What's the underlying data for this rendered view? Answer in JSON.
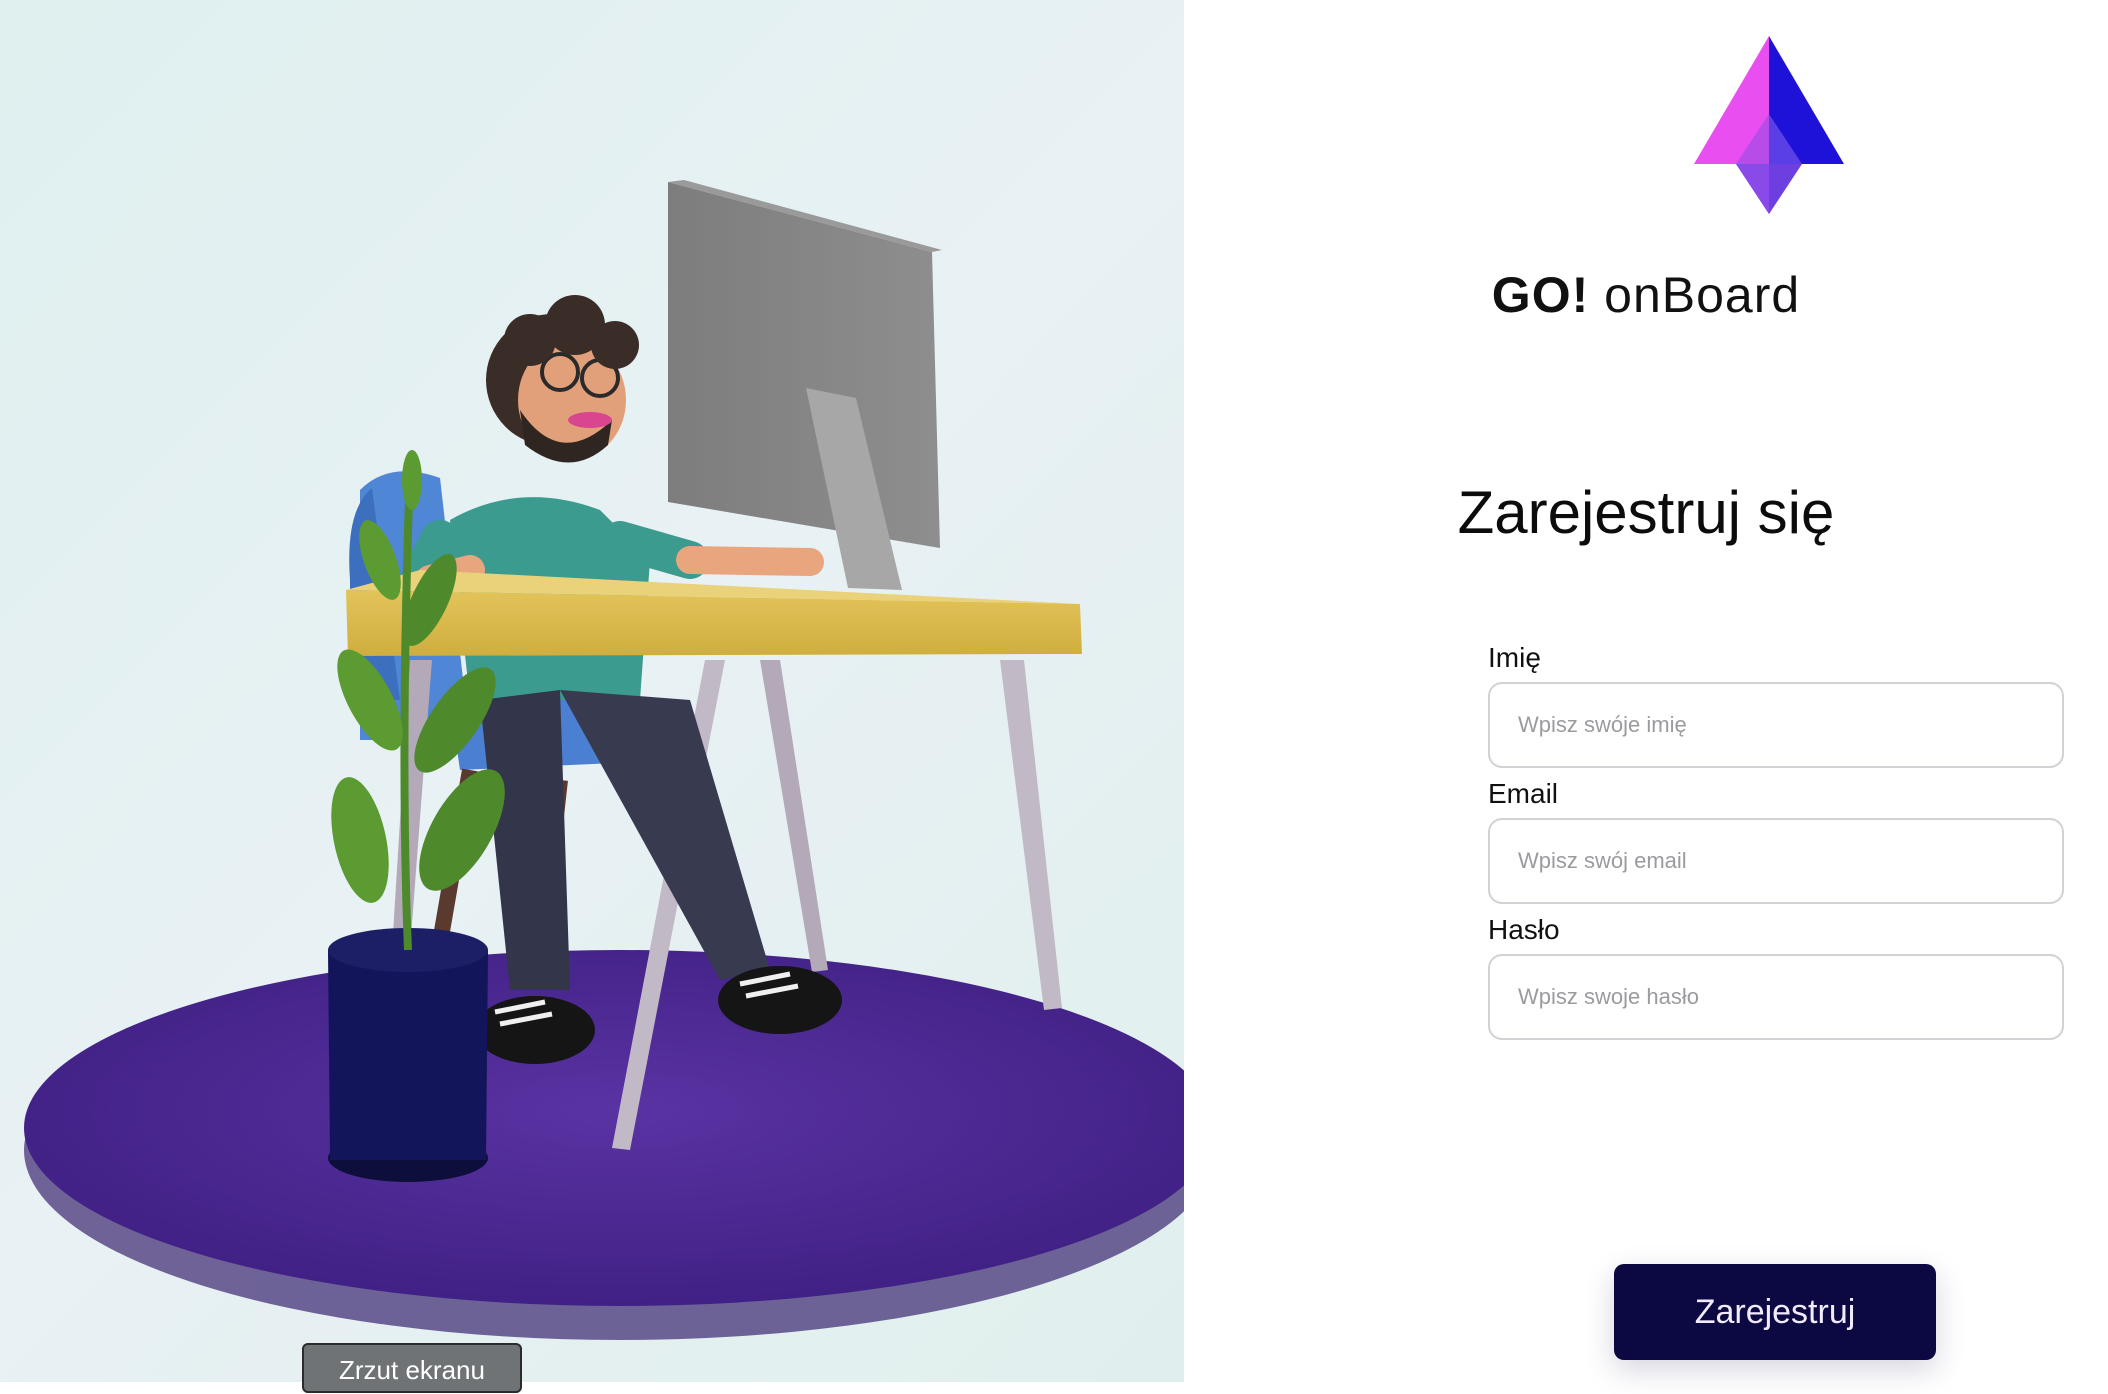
{
  "brand": {
    "name_bold": "GO!",
    "name_light": "onBoard"
  },
  "form": {
    "title": "Zarejestruj się",
    "fields": [
      {
        "label": "Imię",
        "placeholder": "Wpisz swóje imię",
        "value": ""
      },
      {
        "label": "Email",
        "placeholder": "Wpisz swój email",
        "value": ""
      },
      {
        "label": "Hasło",
        "placeholder": "Wpisz swoje hasło",
        "value": ""
      }
    ],
    "submit_label": "Zarejestruj"
  },
  "overlay": {
    "screenshot_button_label": "Zrzut ekranu"
  },
  "colors": {
    "submit_bg": "#0b0842",
    "logo_magenta": "#e84ef0",
    "logo_blue": "#1f12d8",
    "rug_purple": "#4b2a8f"
  }
}
